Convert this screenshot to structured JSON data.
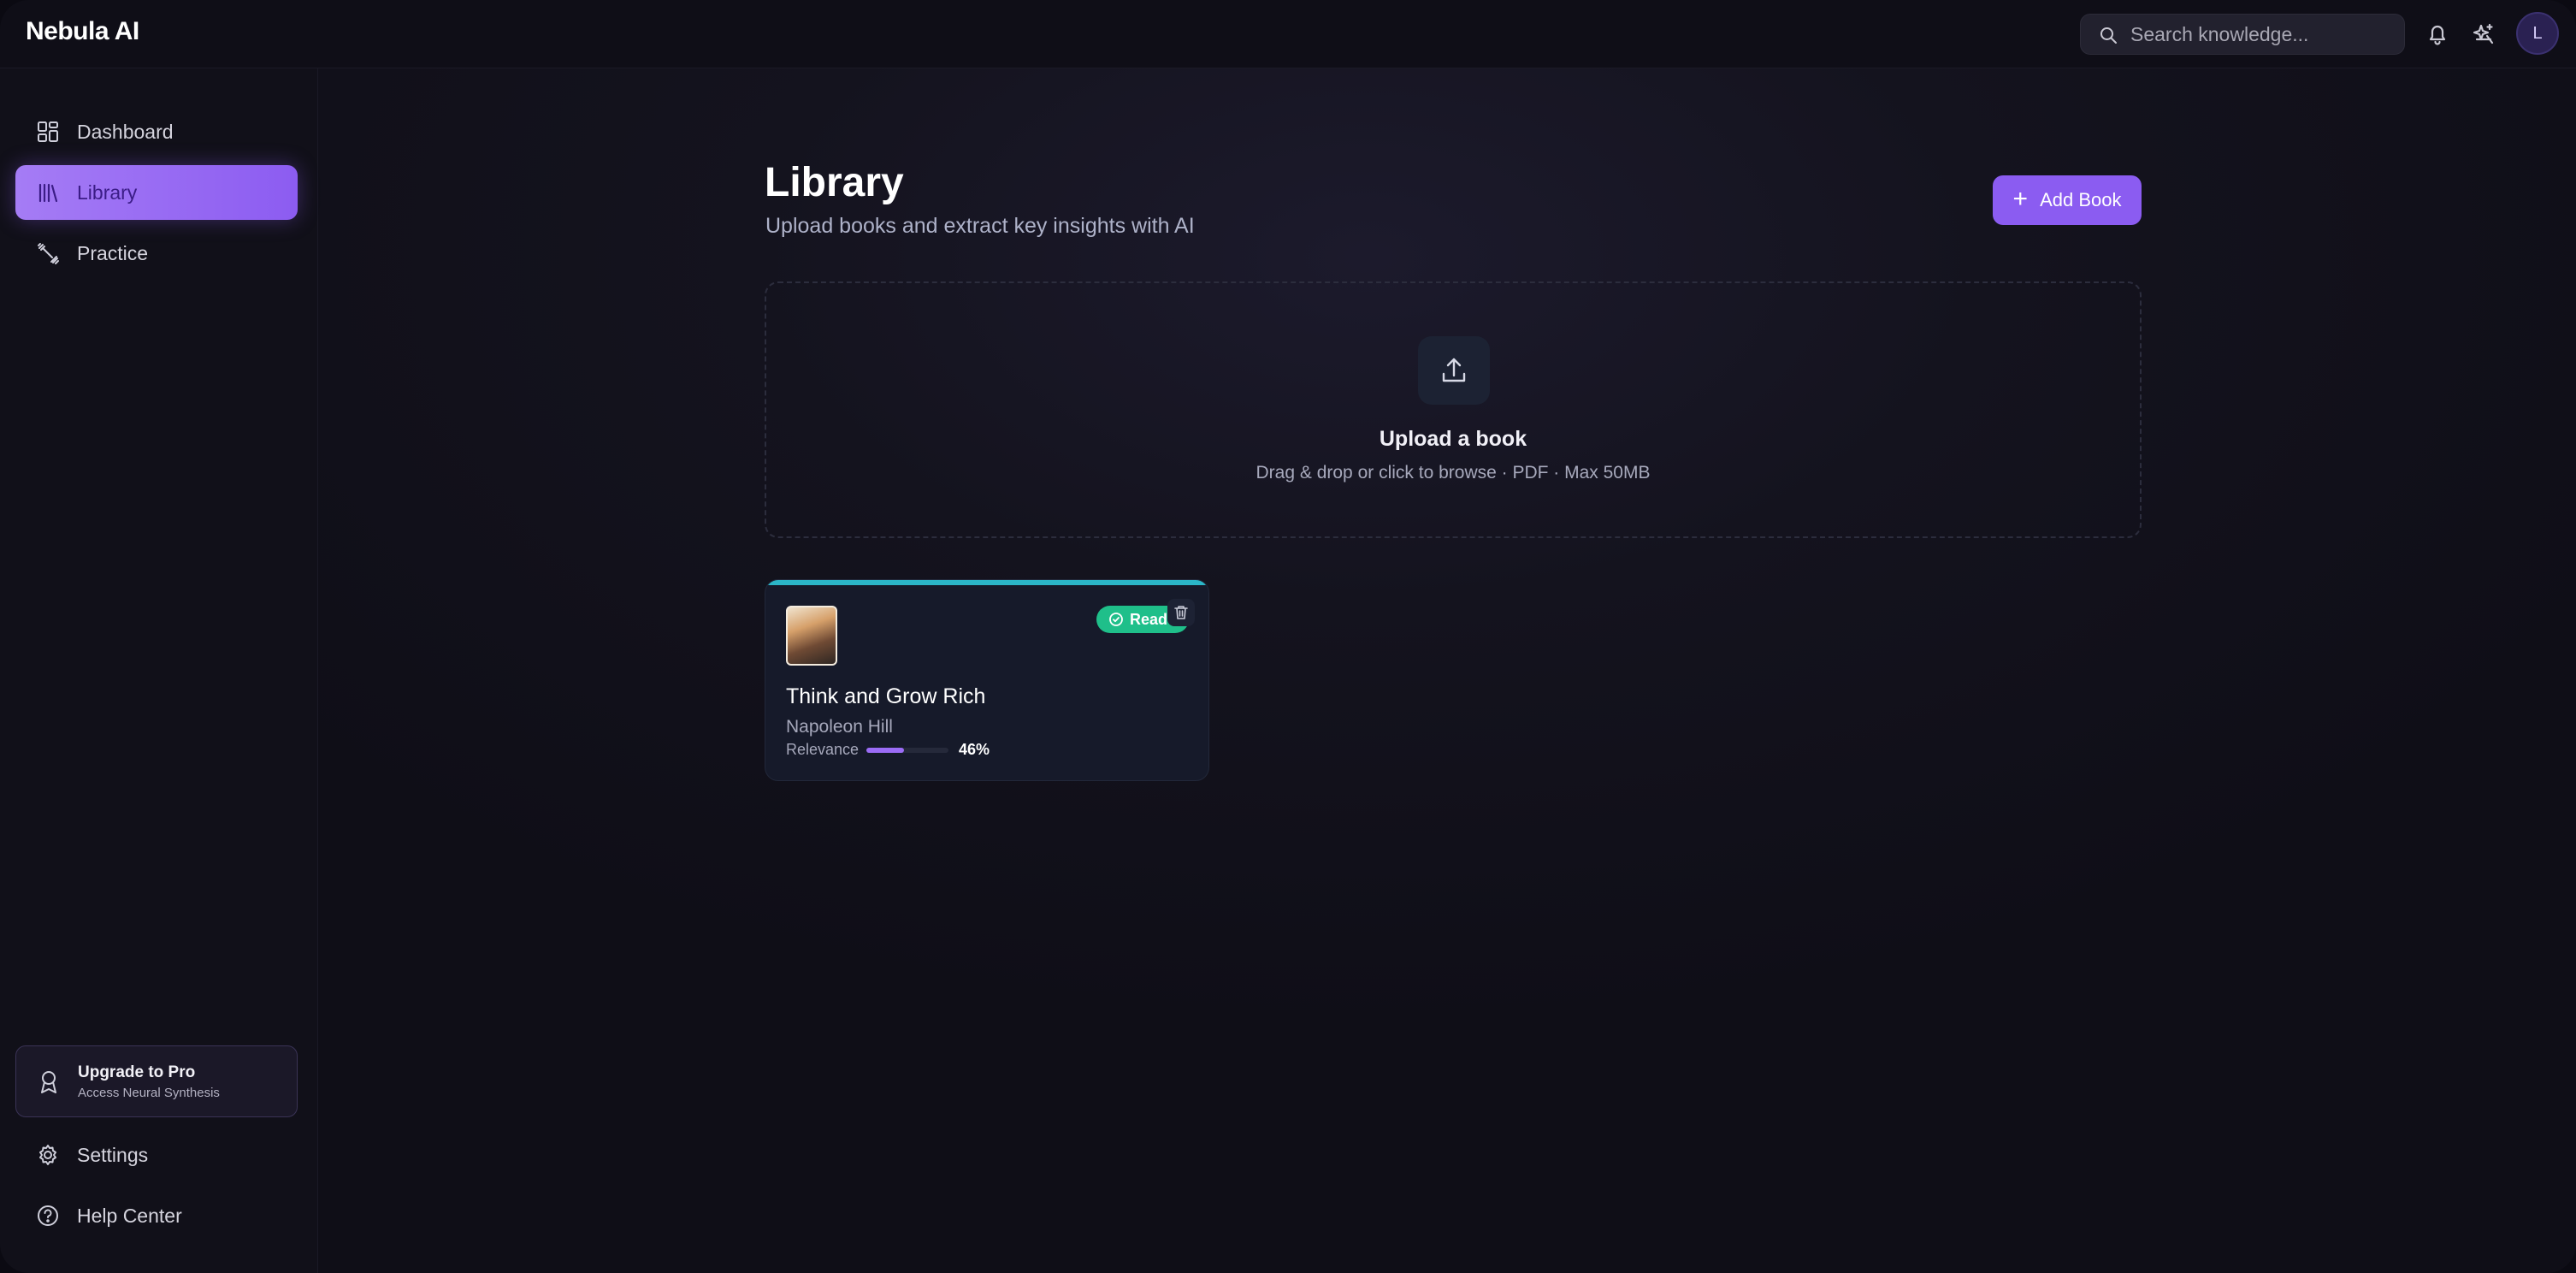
{
  "app": {
    "name": "Nebula AI"
  },
  "topbar": {
    "search_placeholder": "Search knowledge...",
    "avatar_initial": "L"
  },
  "sidebar": {
    "items": [
      {
        "label": "Dashboard",
        "icon": "dashboard-icon"
      },
      {
        "label": "Library",
        "icon": "library-icon",
        "active": true
      },
      {
        "label": "Practice",
        "icon": "practice-icon"
      }
    ],
    "upgrade": {
      "title": "Upgrade to Pro",
      "subtitle": "Access Neural Synthesis",
      "icon": "award-icon"
    },
    "footer_items": [
      {
        "label": "Settings",
        "icon": "gear-icon"
      },
      {
        "label": "Help Center",
        "icon": "help-icon"
      }
    ]
  },
  "main": {
    "title": "Library",
    "subtitle": "Upload books and extract key insights with AI",
    "add_button": "Add Book",
    "upload": {
      "title": "Upload a book",
      "subtitle": "Drag & drop or click to browse · PDF · Max 50MB"
    },
    "books": [
      {
        "title": "Think and Grow Rich",
        "author": "Napoleon Hill",
        "status": "Read",
        "relevance_label": "Relevance",
        "relevance_value": "46%",
        "relevance_fraction": 0.46
      }
    ]
  },
  "colors": {
    "accent": "#8b5cf1",
    "status_ready": "#1fbf8a",
    "card_top_bar": "#2bb6c8",
    "background": "#0f0e17"
  }
}
